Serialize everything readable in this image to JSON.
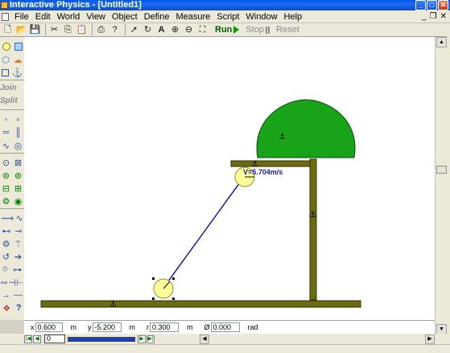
{
  "window": {
    "title": "Interactive Physics - [Untitled1]"
  },
  "menu": [
    "File",
    "Edit",
    "World",
    "View",
    "Object",
    "Define",
    "Measure",
    "Script",
    "Window",
    "Help"
  ],
  "toolbar": {
    "run_label": "Run",
    "stop_label": "Stop",
    "reset_label": "Reset"
  },
  "palette": {
    "join_label": "Join",
    "split_label": "Split"
  },
  "simulation": {
    "velocity_label": "V=5.704m/s",
    "colors": {
      "ground": "#6b6b10",
      "tree_canopy": "#19a319",
      "ball": "#ffff99",
      "rope": "#1a1aa0"
    }
  },
  "coords": {
    "x_label": "x",
    "x_value": "0.600",
    "x_unit": "m",
    "y_label": "y",
    "y_value": "-5.200",
    "y_unit": "m",
    "r_label": "r",
    "r_value": "0.300",
    "r_unit": "m",
    "angle_label": "Ø",
    "angle_value": "0.000",
    "angle_unit": "rad"
  },
  "tape": {
    "frame_value": "0"
  }
}
